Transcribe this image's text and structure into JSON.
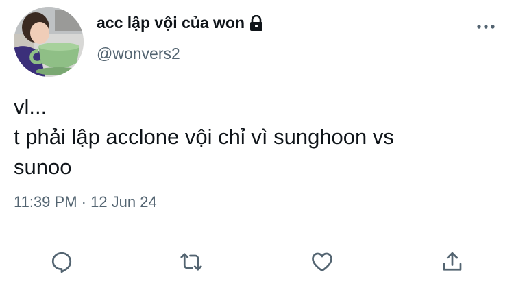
{
  "author": {
    "display_name": "acc lập vội của won",
    "handle": "@wonvers2",
    "protected_icon": "lock-icon",
    "avatar": "profile-photo"
  },
  "tweet": {
    "lines": [
      "vl...",
      "t phải lập acclone vội chỉ vì sunghoon vs",
      "sunoo"
    ],
    "timestamp": "11:39 PM · 12 Jun 24"
  },
  "actions": {
    "icons": [
      "reply-icon",
      "retweet-icon",
      "like-icon",
      "share-icon"
    ],
    "more_icon": "more-options-icon"
  },
  "colors": {
    "text_primary": "#0f1419",
    "text_secondary": "#536471",
    "action_icon": "#536471",
    "divider": "#e1e8ed",
    "cup_green": "#8fbf86"
  }
}
